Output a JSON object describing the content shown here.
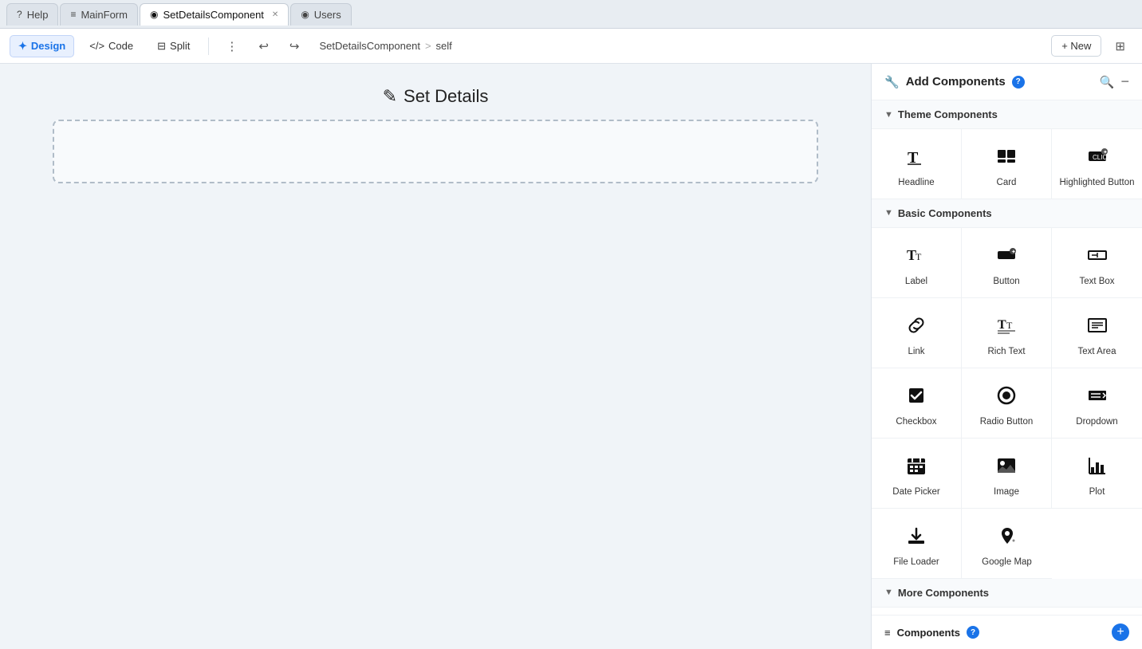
{
  "tabs": [
    {
      "id": "help",
      "label": "Help",
      "icon": "?",
      "active": false,
      "closeable": false
    },
    {
      "id": "mainform",
      "label": "MainForm",
      "icon": "≡",
      "active": false,
      "closeable": false
    },
    {
      "id": "setdetails",
      "label": "SetDetailsComponent",
      "icon": "◉",
      "active": true,
      "closeable": true
    },
    {
      "id": "users",
      "label": "Users",
      "icon": "◉",
      "active": false,
      "closeable": false
    }
  ],
  "toolbar": {
    "design_label": "Design",
    "code_label": "Code",
    "split_label": "Split",
    "breadcrumb_component": "SetDetailsComponent",
    "breadcrumb_sep": ">",
    "breadcrumb_self": "self",
    "new_label": "+ New"
  },
  "canvas": {
    "title": "Set Details",
    "title_icon": "✎"
  },
  "right_panel": {
    "title": "Add Components",
    "help_badge": "?",
    "search_icon": "🔍",
    "close_icon": "−",
    "sections": [
      {
        "id": "theme",
        "label": "Theme Components",
        "collapsed": false,
        "items": [
          {
            "id": "headline",
            "label": "Headline",
            "icon": "headline"
          },
          {
            "id": "card",
            "label": "Card",
            "icon": "card"
          },
          {
            "id": "highlighted-button",
            "label": "Highlighted Button",
            "icon": "highlighted-button"
          }
        ]
      },
      {
        "id": "basic",
        "label": "Basic Components",
        "collapsed": false,
        "items": [
          {
            "id": "label",
            "label": "Label",
            "icon": "label"
          },
          {
            "id": "button",
            "label": "Button",
            "icon": "button"
          },
          {
            "id": "text-box",
            "label": "Text Box",
            "icon": "text-box"
          },
          {
            "id": "link",
            "label": "Link",
            "icon": "link"
          },
          {
            "id": "rich-text",
            "label": "Rich Text",
            "icon": "rich-text"
          },
          {
            "id": "text-area",
            "label": "Text Area",
            "icon": "text-area"
          },
          {
            "id": "checkbox",
            "label": "Checkbox",
            "icon": "checkbox"
          },
          {
            "id": "radio-button",
            "label": "Radio Button",
            "icon": "radio-button"
          },
          {
            "id": "dropdown",
            "label": "Dropdown",
            "icon": "dropdown"
          },
          {
            "id": "date-picker",
            "label": "Date Picker",
            "icon": "date-picker"
          },
          {
            "id": "image",
            "label": "Image",
            "icon": "image"
          },
          {
            "id": "plot",
            "label": "Plot",
            "icon": "plot"
          },
          {
            "id": "file-loader",
            "label": "File Loader",
            "icon": "file-loader"
          },
          {
            "id": "google-map",
            "label": "Google Map",
            "icon": "google-map"
          }
        ]
      },
      {
        "id": "more",
        "label": "More Components",
        "collapsed": false,
        "items": []
      }
    ]
  },
  "bottom_bar": {
    "label": "Components",
    "help_badge": "?"
  }
}
